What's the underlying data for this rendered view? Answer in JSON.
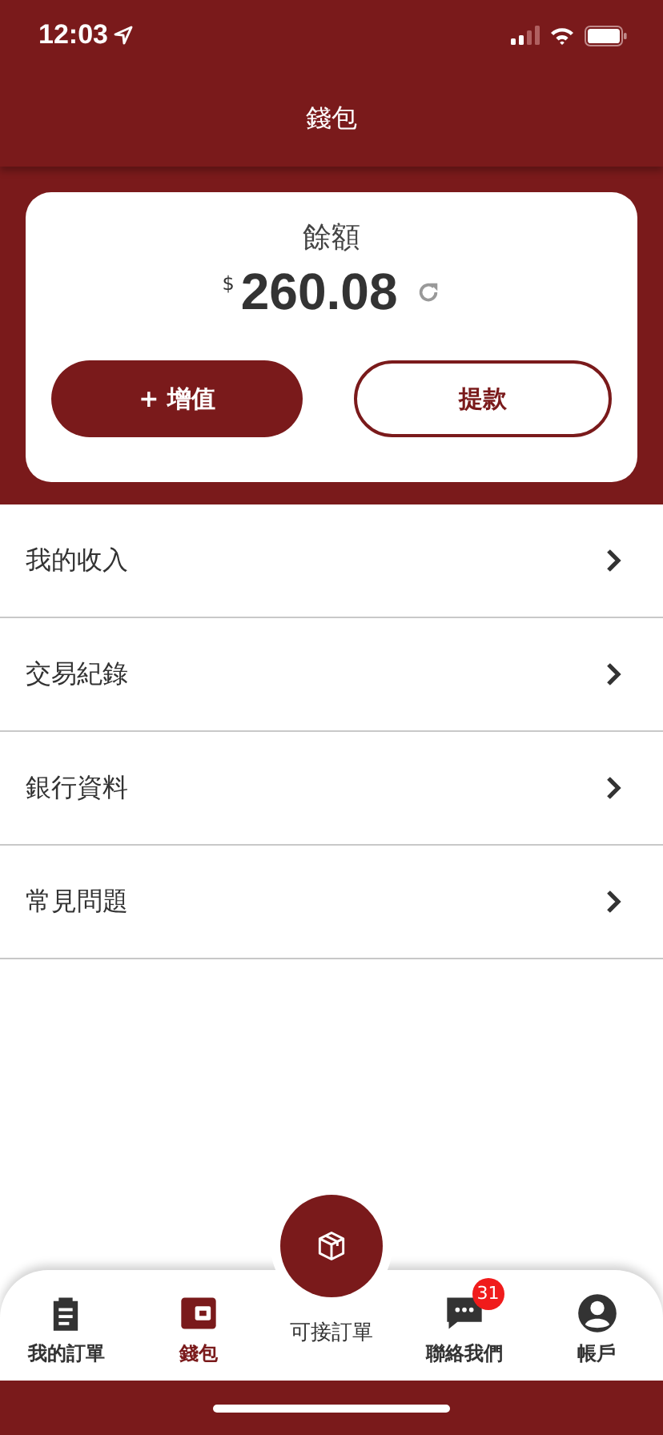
{
  "status_bar": {
    "time": "12:03"
  },
  "header": {
    "title": "錢包"
  },
  "balance": {
    "label": "餘額",
    "currency": "$",
    "amount": "260.08"
  },
  "buttons": [
    {
      "label": "+ 增值",
      "kind": "filled"
    },
    {
      "label": "提款",
      "kind": "outline"
    }
  ],
  "menu": [
    {
      "label": "我的收入"
    },
    {
      "label": "交易紀錄"
    },
    {
      "label": "銀行資料"
    },
    {
      "label": "常見問題"
    }
  ],
  "tabs": [
    {
      "label": "我的訂單",
      "kind": "orders",
      "selected": false
    },
    {
      "label": "錢包",
      "kind": "wallet",
      "selected": true
    },
    {
      "label": "可接訂單",
      "kind": "center",
      "selected": false
    },
    {
      "label": "聯絡我們",
      "kind": "chat",
      "selected": false,
      "badge": "31"
    },
    {
      "label": "帳戶",
      "kind": "account",
      "selected": false
    }
  ]
}
